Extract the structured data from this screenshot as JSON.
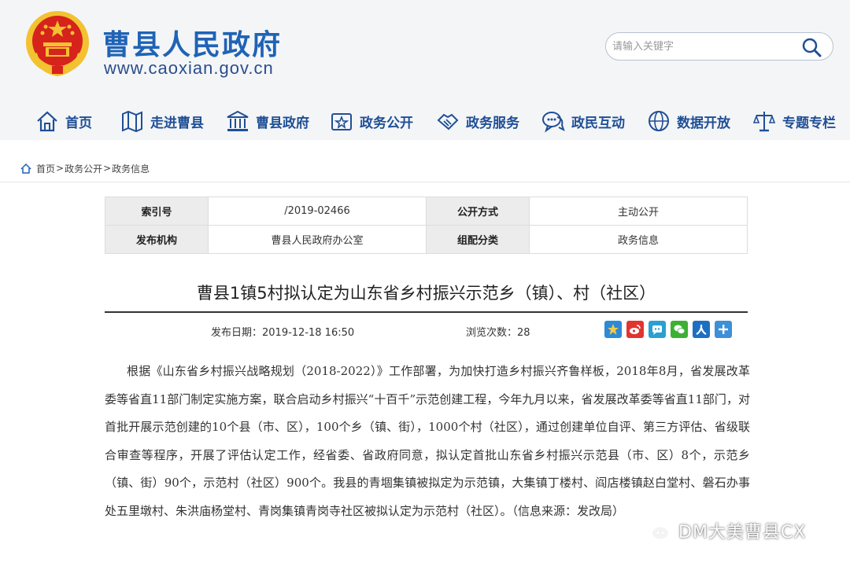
{
  "header": {
    "title": "曹县人民政府",
    "url": "www.caoxian.gov.cn",
    "search_placeholder": "请输入关键字"
  },
  "nav": [
    {
      "label": "首页",
      "icon": "home-icon"
    },
    {
      "label": "走进曹县",
      "icon": "map-icon"
    },
    {
      "label": "曹县政府",
      "icon": "government-building-icon"
    },
    {
      "label": "政务公开",
      "icon": "bulletin-board-icon"
    },
    {
      "label": "政务服务",
      "icon": "handshake-icon"
    },
    {
      "label": "政民互动",
      "icon": "chat-bubble-icon"
    },
    {
      "label": "数据开放",
      "icon": "data-globe-icon"
    },
    {
      "label": "专题专栏",
      "icon": "scales-icon"
    }
  ],
  "breadcrumb": [
    "首页",
    "政务公开",
    "政务信息"
  ],
  "info": {
    "index_label": "索引号",
    "index_value": "/2019-02466",
    "mode_label": "公开方式",
    "mode_value": "主动公开",
    "org_label": "发布机构",
    "org_value": "曹县人民政府办公室",
    "category_label": "组配分类",
    "category_value": "政务信息"
  },
  "article": {
    "title": "曹县1镇5村拟认定为山东省乡村振兴示范乡（镇）、村（社区）",
    "publish_date": "发布日期：2019-12-18 16:50",
    "views": "浏览次数：28",
    "body": "根据《山东省乡村振兴战略规划（2018-2022）》工作部署，为加快打造乡村振兴齐鲁样板，2018年8月，省发展改革委等省直11部门制定实施方案，联合启动乡村振兴“十百千”示范创建工程，今年九月以来，省发展改革委等省直11部门，对首批开展示范创建的10个县（市、区），100个乡（镇、街），1000个村（社区），通过创建单位自评、第三方评估、省级联合审查等程序，开展了评估认定工作，经省委、省政府同意，拟认定首批山东省乡村振兴示范县（市、区）8个，示范乡（镇、街）90个，示范村（社区）900个。我县的青堌集镇被拟定为示范镇，大集镇丁楼村、阎店楼镇赵白堂村、磐石办事处五里墩村、朱洪庙杨堂村、青岗集镇青岗寺社区被拟认定为示范村（社区）。（信息来源：发改局）"
  },
  "share": [
    {
      "name": "qzone-share-button",
      "color": "#2d8ad6"
    },
    {
      "name": "weibo-share-button",
      "color": "#e2342f"
    },
    {
      "name": "tencent-weibo-share-button",
      "color": "#2aa0d2"
    },
    {
      "name": "wechat-share-button",
      "color": "#3cb035"
    },
    {
      "name": "renren-share-button",
      "color": "#1d6fc2"
    },
    {
      "name": "more-share-button",
      "color": "#3d8fd8"
    }
  ],
  "watermark": {
    "text": "DM大美曹县CX"
  },
  "colors": {
    "brand_blue": "#1f63b5",
    "nav_blue": "#1f4f96",
    "header_bg": "#f4f5f7",
    "emblem_red": "#d6231b",
    "emblem_gold": "#f2c230"
  }
}
